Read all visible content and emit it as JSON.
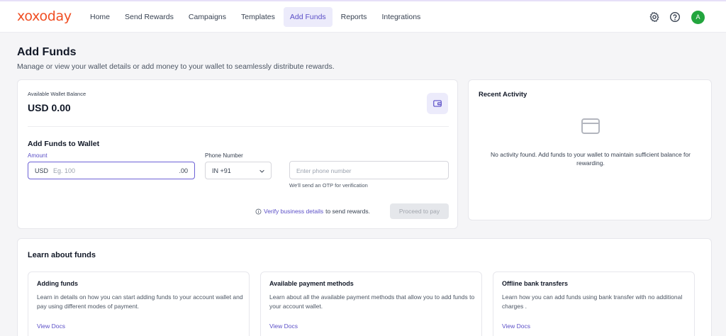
{
  "header": {
    "logo": "xoxoday",
    "nav": [
      "Home",
      "Send Rewards",
      "Campaigns",
      "Templates",
      "Add Funds",
      "Reports",
      "Integrations"
    ],
    "active_nav": "Add Funds",
    "icons": [
      "gear-icon",
      "help-circle-icon"
    ],
    "avatar_initial": "A",
    "avatar_color": "#22a53d"
  },
  "page": {
    "title": "Add Funds",
    "subtitle": "Manage or view your wallet details or add money to your wallet to seamlessly distribute rewards."
  },
  "wallet": {
    "balance_label": "Available Wallet Balance",
    "balance": "USD 0.00",
    "add_title": "Add Funds to Wallet",
    "amount_label": "Amount",
    "currency": "USD",
    "amount_placeholder": "Eg. 100",
    "amount_decimal": ".00",
    "phone_label": "Phone Number",
    "country_code": "IN +91",
    "phone_placeholder": "Enter phone number",
    "otp_note": "We'll send an OTP for verification",
    "verify_link": "Verify business details",
    "verify_suffix": "to send rewards.",
    "proceed_label": "Proceed to pay"
  },
  "activity": {
    "title": "Recent Activity",
    "empty_text": "No activity found. Add funds to your wallet to maintain sufficient balance for rewarding."
  },
  "learn": {
    "title": "Learn about funds",
    "cards": [
      {
        "title": "Adding funds",
        "desc": "Learn in details on how you can start adding funds to your account wallet and pay using different modes of payment.",
        "link": "View Docs"
      },
      {
        "title": "Available payment methods",
        "desc": "Learn about all the available payment methods that allow you to add funds to your account wallet.",
        "link": "View Docs"
      },
      {
        "title": "Offline bank transfers",
        "desc": "Learn how you can add funds using bank transfer with no additional charges .",
        "link": "View Docs"
      }
    ]
  },
  "colors": {
    "accent": "#5b4fc7",
    "accent_bg": "#ecebfb",
    "logo": "#f04e23"
  }
}
